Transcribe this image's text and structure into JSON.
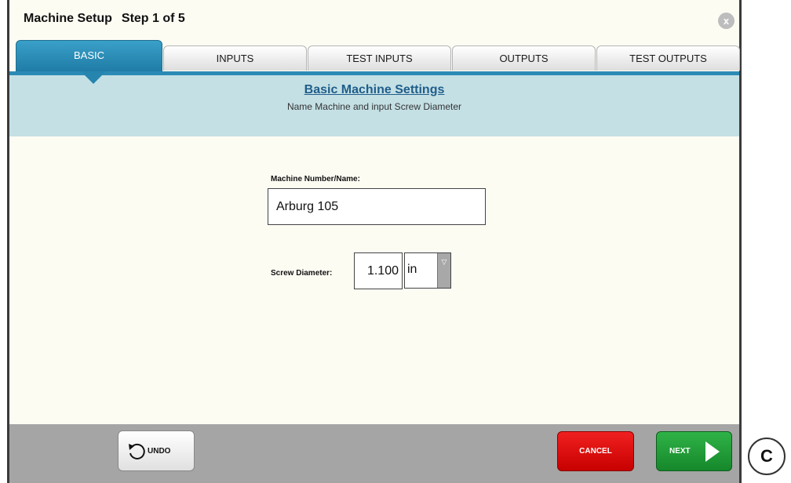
{
  "window": {
    "title": "Machine Setup",
    "step": "Step 1 of 5",
    "close_glyph": "x"
  },
  "tabs": [
    {
      "label": "BASIC",
      "active": true
    },
    {
      "label": "INPUTS",
      "active": false
    },
    {
      "label": "TEST INPUTS",
      "active": false
    },
    {
      "label": "OUTPUTS",
      "active": false
    },
    {
      "label": "TEST OUTPUTS",
      "active": false
    }
  ],
  "header": {
    "title": "Basic Machine Settings",
    "subtitle": "Name Machine and input Screw Diameter"
  },
  "form": {
    "machine_label": "Machine Number/Name:",
    "machine_value": "Arburg 105",
    "screw_label": "Screw Diameter:",
    "screw_value": "1.100",
    "screw_unit": "in",
    "unit_arrow_icon": "triangle-down-icon"
  },
  "footer": {
    "undo_label": "UNDO",
    "cancel_label": "CANCEL",
    "next_label": "NEXT"
  },
  "badge": "C",
  "colors": {
    "active_tab": "#2585ae",
    "header_band": "#c4e0e5",
    "cancel": "#e00000",
    "next": "#1f9e36"
  }
}
